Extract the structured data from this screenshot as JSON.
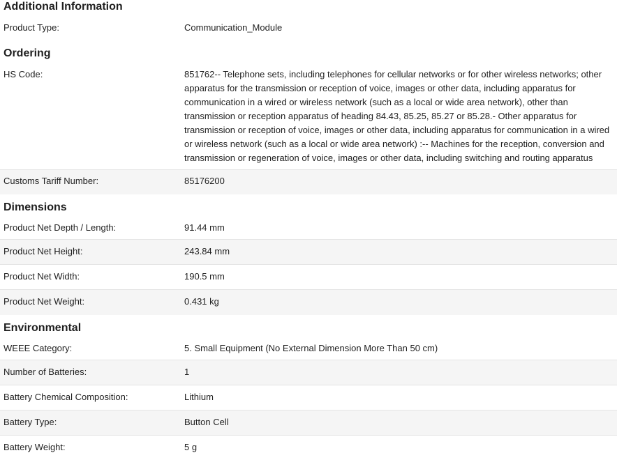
{
  "sections": [
    {
      "title": "Additional Information",
      "rows": [
        {
          "label": "Product Type:",
          "value": "Communication_Module"
        }
      ]
    },
    {
      "title": "Ordering",
      "rows": [
        {
          "label": "HS Code:",
          "value": "851762-- Telephone sets, including telephones for cellular networks or for other wireless networks; other apparatus for the transmission or reception of voice, images or other data, including apparatus for communication in a wired or wireless network (such as a local or wide area network), other than transmission or reception apparatus of heading 84.43, 85.25, 85.27 or 85.28.- Other apparatus for transmission or reception of voice, images or other data, including apparatus for communication in a wired or wireless network (such as a local or wide area network) :-- Machines for the reception, conversion and transmission or regeneration of voice, images or other data, including switching and routing apparatus"
        },
        {
          "label": "Customs Tariff Number:",
          "value": "85176200"
        }
      ]
    },
    {
      "title": "Dimensions",
      "rows": [
        {
          "label": "Product Net Depth / Length:",
          "value": "91.44 mm"
        },
        {
          "label": "Product Net Height:",
          "value": "243.84 mm"
        },
        {
          "label": "Product Net Width:",
          "value": "190.5 mm"
        },
        {
          "label": "Product Net Weight:",
          "value": "0.431 kg"
        }
      ]
    },
    {
      "title": "Environmental",
      "rows": [
        {
          "label": "WEEE Category:",
          "value": "5. Small Equipment (No External Dimension More Than 50 cm)"
        },
        {
          "label": "Number of Batteries:",
          "value": "1"
        },
        {
          "label": "Battery Chemical Composition:",
          "value": "Lithium"
        },
        {
          "label": "Battery Type:",
          "value": "Button Cell"
        },
        {
          "label": "Battery Weight:",
          "value": "5 g"
        }
      ]
    }
  ]
}
